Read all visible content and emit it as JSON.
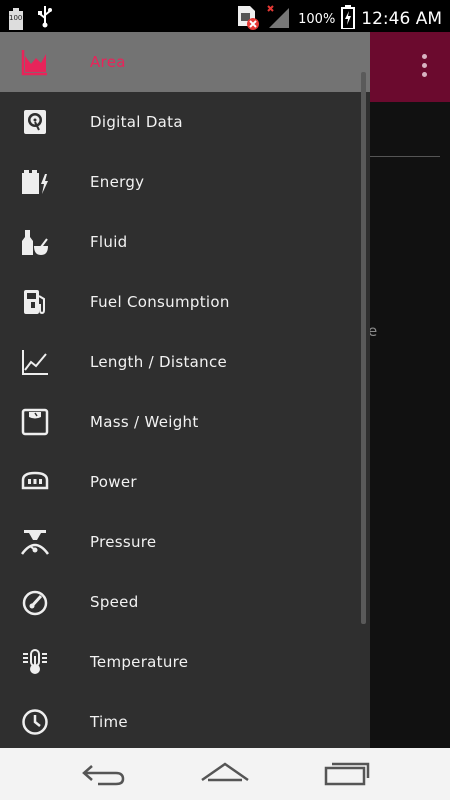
{
  "status_bar": {
    "battery_small_label": "100",
    "battery_percent": "100%",
    "time": "12:46 AM"
  },
  "background": {
    "partial_text": "e"
  },
  "drawer": {
    "items": [
      {
        "label": "Area",
        "icon": "area-chart-icon",
        "active": true
      },
      {
        "label": "Digital Data",
        "icon": "hard-drive-icon",
        "active": false
      },
      {
        "label": "Energy",
        "icon": "battery-bolt-icon",
        "active": false
      },
      {
        "label": "Fluid",
        "icon": "bottle-bowl-icon",
        "active": false
      },
      {
        "label": "Fuel Consumption",
        "icon": "fuel-pump-icon",
        "active": false
      },
      {
        "label": "Length / Distance",
        "icon": "line-graph-icon",
        "active": false
      },
      {
        "label": "Mass / Weight",
        "icon": "scale-icon",
        "active": false
      },
      {
        "label": "Power",
        "icon": "power-meter-icon",
        "active": false
      },
      {
        "label": "Pressure",
        "icon": "pressure-gauge-icon",
        "active": false
      },
      {
        "label": "Speed",
        "icon": "speedometer-icon",
        "active": false
      },
      {
        "label": "Temperature",
        "icon": "thermometer-icon",
        "active": false
      },
      {
        "label": "Time",
        "icon": "clock-icon",
        "active": false
      }
    ]
  },
  "colors": {
    "accent": "#e8245a",
    "appbar": "#6b0a2e",
    "drawer_bg": "#2f2f2f",
    "active_row": "#737373"
  }
}
